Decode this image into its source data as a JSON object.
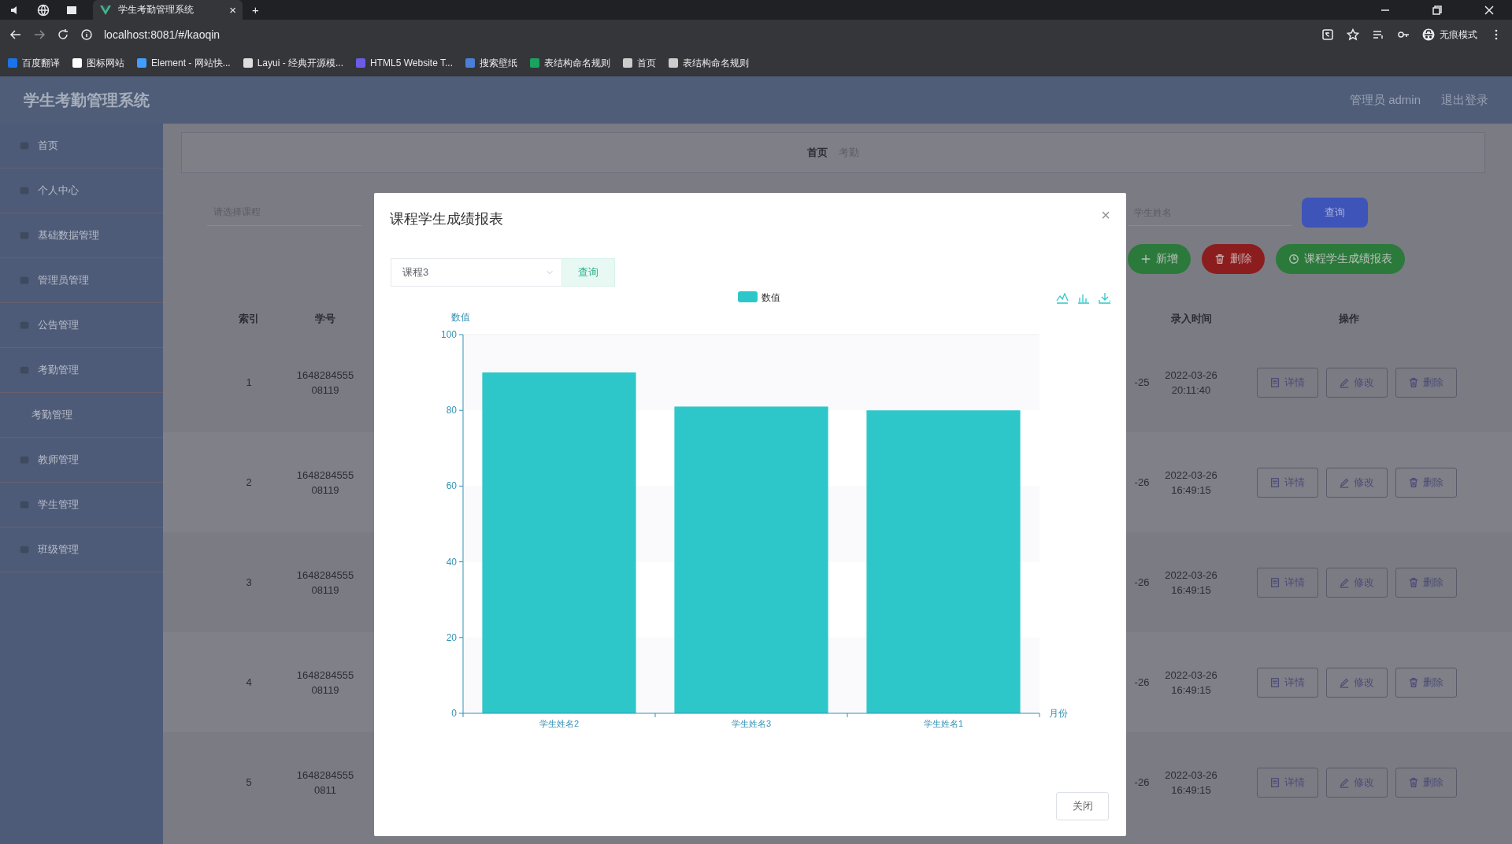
{
  "browser": {
    "tab": {
      "title": "学生考勤管理系统",
      "close": "×"
    },
    "new_tab": "+",
    "address": "localhost:8081/#/kaoqin",
    "profile": "无痕模式",
    "bookmarks": [
      {
        "label": "百度翻译",
        "color": "#1a73e8"
      },
      {
        "label": "图标网站",
        "color": "#ffffff"
      },
      {
        "label": "Element - 网站快...",
        "color": "#409eff"
      },
      {
        "label": "Layui - 经典开源模...",
        "color": "#dddddd"
      },
      {
        "label": "HTML5 Website T...",
        "color": "#6b5ce7"
      },
      {
        "label": "搜索壁纸",
        "color": "#4a7fd8"
      },
      {
        "label": "表结构命名规则",
        "color": "#1aa260"
      },
      {
        "label": "首页",
        "color": "#cccccc"
      },
      {
        "label": "表结构命名规则",
        "color": "#cccccc"
      }
    ]
  },
  "header": {
    "title": "学生考勤管理系统",
    "user": "管理员 admin",
    "logout": "退出登录"
  },
  "sidebar": {
    "items": [
      {
        "label": "首页"
      },
      {
        "label": "个人中心"
      },
      {
        "label": "基础数据管理"
      },
      {
        "label": "管理员管理"
      },
      {
        "label": "公告管理"
      },
      {
        "label": "考勤管理",
        "children": [
          {
            "label": "考勤管理"
          }
        ]
      },
      {
        "label": "教师管理"
      },
      {
        "label": "学生管理"
      },
      {
        "label": "班级管理"
      }
    ]
  },
  "breadcrumb": [
    "首页",
    "考勤"
  ],
  "filters": {
    "select": {
      "placeholder": "请选择课程"
    },
    "search": {
      "placeholder": "学生姓名"
    },
    "search_button": "查询"
  },
  "actions": [
    {
      "label": "新增",
      "kind": "add"
    },
    {
      "label": "删除",
      "kind": "delete"
    },
    {
      "label": "课程学生成绩报表",
      "kind": "report"
    }
  ],
  "table": {
    "columns": [
      "索引",
      "学号",
      "录入时间",
      "操作"
    ],
    "rows": [
      {
        "index": "1",
        "student_no": "164828455508119",
        "column_3": "-25",
        "entry_time": "2022-03-26 20:11:40",
        "actions": [
          {
            "label": "详情",
            "kind": "detail"
          },
          {
            "label": "修改",
            "kind": "edit"
          },
          {
            "label": "删除",
            "kind": "delete"
          }
        ]
      },
      {
        "index": "2",
        "student_no": "164828455508119",
        "column_3": "-26",
        "entry_time": "2022-03-26 16:49:15",
        "actions": [
          {
            "label": "详情",
            "kind": "detail"
          },
          {
            "label": "修改",
            "kind": "edit"
          },
          {
            "label": "删除",
            "kind": "delete"
          }
        ]
      },
      {
        "index": "3",
        "student_no": "164828455508119",
        "column_3": "-26",
        "entry_time": "2022-03-26 16:49:15",
        "actions": [
          {
            "label": "详情",
            "kind": "detail"
          },
          {
            "label": "修改",
            "kind": "edit"
          },
          {
            "label": "删除",
            "kind": "delete"
          }
        ]
      },
      {
        "index": "4",
        "student_no": "164828455508119",
        "column_3": "-26",
        "entry_time": "2022-03-26 16:49:15",
        "actions": [
          {
            "label": "详情",
            "kind": "detail"
          },
          {
            "label": "修改",
            "kind": "edit"
          },
          {
            "label": "删除",
            "kind": "delete"
          }
        ]
      },
      {
        "index": "5",
        "student_no": "16482845550811",
        "column_3": "-26",
        "entry_time": "2022-03-26 16:49:15",
        "actions": [
          {
            "label": "详情",
            "kind": "detail"
          },
          {
            "label": "修改",
            "kind": "edit"
          },
          {
            "label": "删除",
            "kind": "delete"
          }
        ]
      }
    ]
  },
  "dialog": {
    "title": "课程学生成绩报表",
    "close": "×",
    "course_select": {
      "value": "课程3"
    },
    "query_button": "查询",
    "footer_button": "关闭",
    "chart_data": {
      "type": "bar",
      "xlabel": "月份",
      "ylabel": "数值",
      "categories": [
        "学生姓名2",
        "学生姓名3",
        "学生姓名1"
      ],
      "series": [
        {
          "name": "数值",
          "color": "#2ec7c9",
          "values": [
            90,
            81,
            80
          ]
        }
      ],
      "ylim": [
        0,
        100
      ],
      "yticks": [
        0,
        20,
        40,
        60,
        80,
        100
      ]
    }
  }
}
